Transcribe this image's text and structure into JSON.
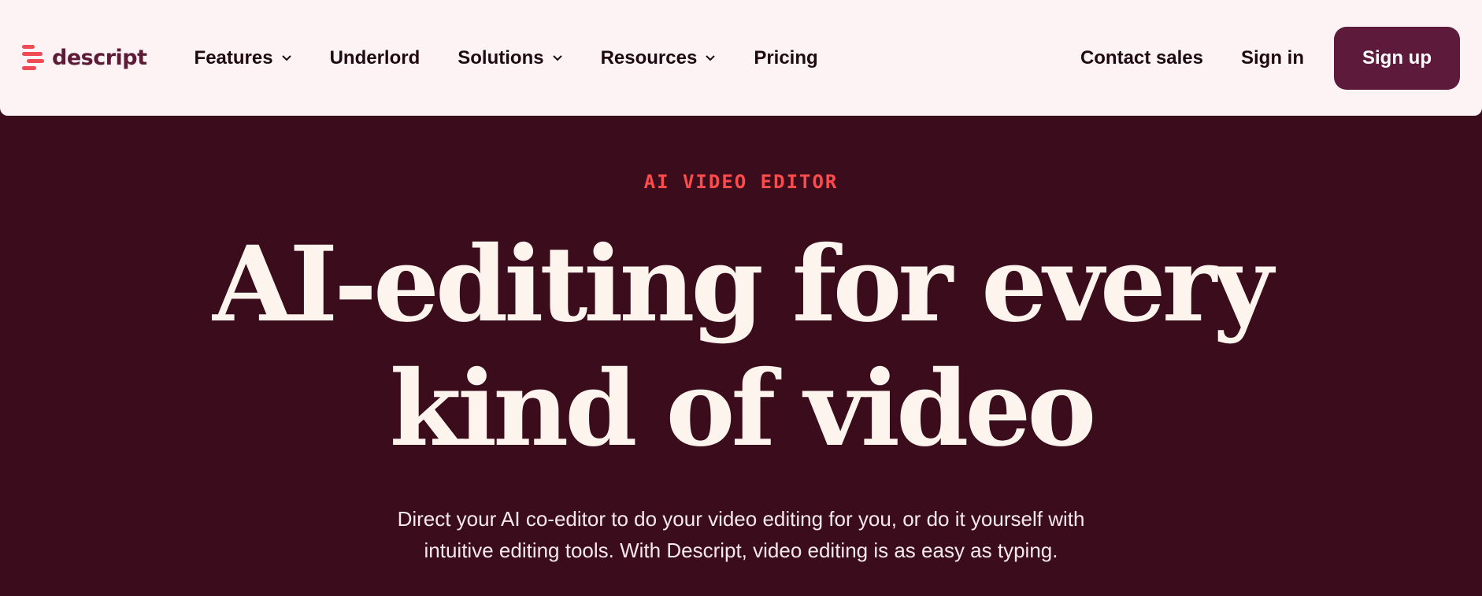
{
  "brand": {
    "name": "descript",
    "logo_color": "#ef4b56"
  },
  "nav": {
    "items": [
      {
        "label": "Features",
        "dropdown": true
      },
      {
        "label": "Underlord",
        "dropdown": false
      },
      {
        "label": "Solutions",
        "dropdown": true
      },
      {
        "label": "Resources",
        "dropdown": true
      },
      {
        "label": "Pricing",
        "dropdown": false
      }
    ],
    "contact_label": "Contact sales",
    "signin_label": "Sign in",
    "signup_label": "Sign up"
  },
  "hero": {
    "eyebrow": "AI VIDEO EDITOR",
    "headline_line1": "AI-editing for every",
    "headline_line2": "kind of video",
    "subtext_line1": "Direct your AI co-editor to do your video editing for you, or do it yourself with",
    "subtext_line2": "intuitive editing tools. With Descript, video editing is as easy as typing."
  },
  "colors": {
    "nav_bg": "#fdf3f5",
    "hero_bg": "#3a0c1c",
    "accent": "#ff4b4b",
    "signup_bg": "#5e1a3b",
    "headline": "#fdf4ee"
  },
  "icons": [
    "descript-logo-icon",
    "chevron-down-icon"
  ]
}
